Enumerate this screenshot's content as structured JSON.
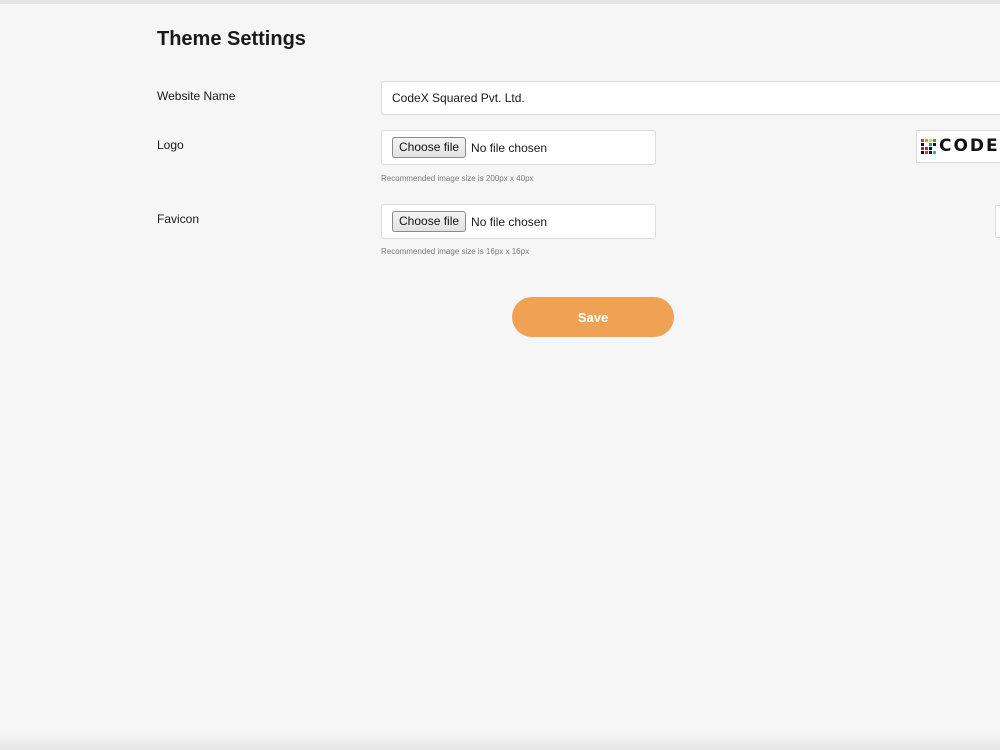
{
  "page": {
    "title": "Theme Settings"
  },
  "form": {
    "website_name": {
      "label": "Website Name",
      "value": "CodeX Squared Pvt. Ltd."
    },
    "logo": {
      "label": "Logo",
      "button_label": "Choose file",
      "status": "No file chosen",
      "hint": "Recommended image size is 200px x 40px",
      "preview_text": "CODE"
    },
    "favicon": {
      "label": "Favicon",
      "button_label": "Choose file",
      "status": "No file chosen",
      "hint": "Recommended image size is 16px x 16px"
    },
    "save_label": "Save"
  },
  "colors": {
    "background": "#f6f6f6",
    "accent": "#f0a254",
    "input_border": "#dcdcdc"
  },
  "icons": {
    "logo_preview": "codex-logo-icon",
    "favicon_preview": "favicon-thumbnail-icon"
  }
}
